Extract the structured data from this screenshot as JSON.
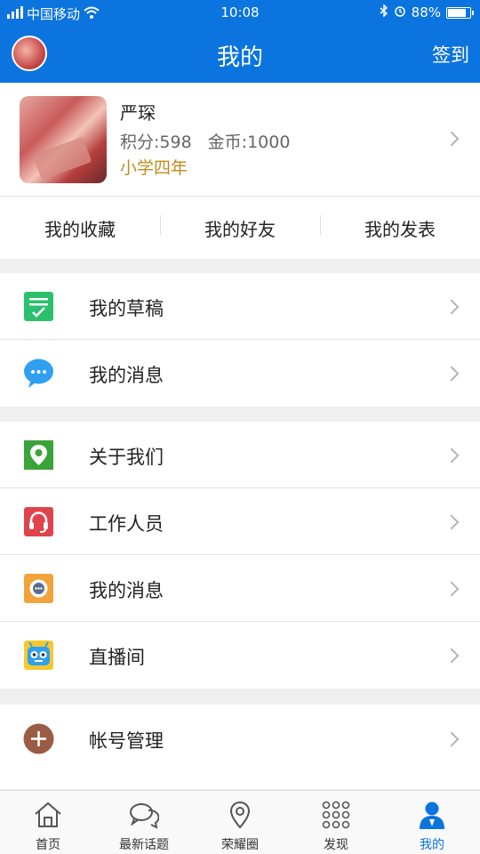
{
  "status_bar": {
    "carrier": "中国移动",
    "time": "10:08",
    "battery": "88%",
    "battery_level": 0.88
  },
  "header": {
    "title": "我的",
    "signin_label": "签到"
  },
  "profile": {
    "name": "严琛",
    "points": "积分:598",
    "coins": "金币:1000",
    "grade": "小学四年"
  },
  "quick_links": [
    "我的收藏",
    "我的好友",
    "我的发表"
  ],
  "menu_sections": [
    [
      {
        "label": "我的草稿",
        "icon": "draft-icon",
        "color": "#2bc06c"
      },
      {
        "label": "我的消息",
        "icon": "chat-bubble-icon",
        "color": "#2f9ff0"
      }
    ],
    [
      {
        "label": "关于我们",
        "icon": "location-pin-icon",
        "color": "#3aa33a"
      },
      {
        "label": "工作人员",
        "icon": "headset-icon",
        "color": "#e0434b"
      },
      {
        "label": "我的消息",
        "icon": "message-icon",
        "color": "#f3a33b"
      },
      {
        "label": "直播间",
        "icon": "tv-robot-icon",
        "color": "#f5c92e"
      }
    ],
    [
      {
        "label": "帐号管理",
        "icon": "plus-circle-icon",
        "color": "#9a5c44"
      }
    ]
  ],
  "tab_bar": [
    {
      "label": "首页",
      "icon": "home-icon"
    },
    {
      "label": "最新话题",
      "icon": "chat-icon"
    },
    {
      "label": "荣耀圈",
      "icon": "location-icon"
    },
    {
      "label": "发现",
      "icon": "grid-dots-icon"
    },
    {
      "label": "我的",
      "icon": "user-icon",
      "active": true
    }
  ]
}
